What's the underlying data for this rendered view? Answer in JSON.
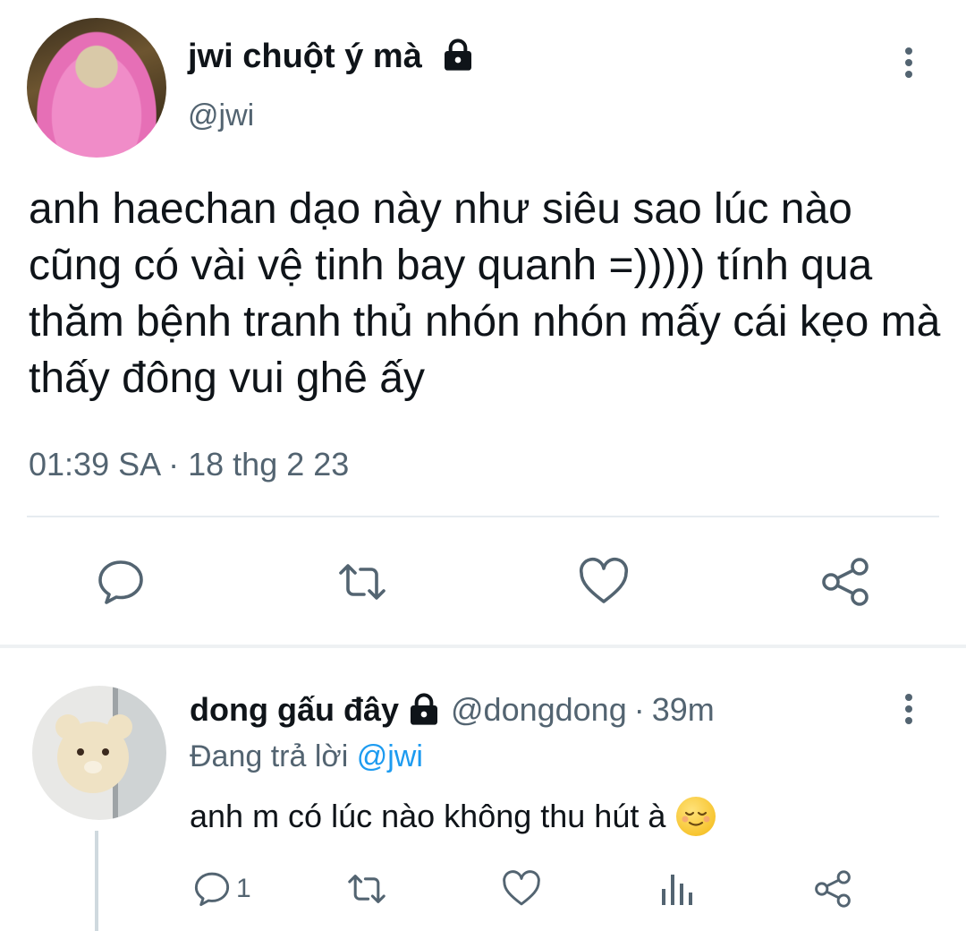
{
  "tweet": {
    "author_name": "jwi chuột ý mà",
    "author_handle": "@jwi",
    "text": "anh haechan dạo này như siêu sao lúc nào cũng có vài vệ tinh bay quanh =))))) tính qua thăm bệnh tranh thủ nhón nhón mấy cái kẹo mà thấy đông vui ghê ấy",
    "timestamp": "01:39 SA · 18 thg 2 23"
  },
  "actions": {
    "reply_icon": "reply-icon",
    "retweet_icon": "retweet-icon",
    "like_icon": "like-icon",
    "share_icon": "share-icon"
  },
  "reply": {
    "author_name": "dong gấu đây",
    "author_handle": "@dongdong",
    "separator": "·",
    "time_ago": "39m",
    "replying_prefix": "Đang trả lời",
    "replying_to": "@jwi",
    "text": "anh m có lúc nào không thu hút à",
    "emoji": "relieved-face-emoji",
    "reply_count": "1"
  },
  "colors": {
    "text_primary": "#0f1419",
    "text_secondary": "#536471",
    "link": "#1d9bf0",
    "divider": "#e6ecf0"
  }
}
